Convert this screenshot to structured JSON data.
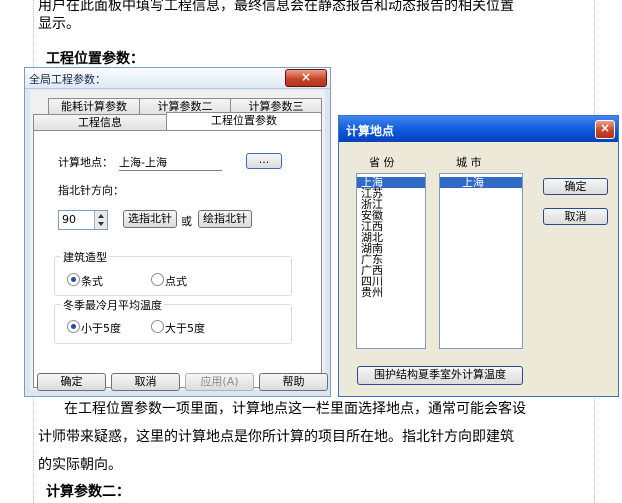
{
  "document": {
    "top_paragraph": [
      "用户在此面板中填写工程信息，最终信息会在静态报告和动态报告的相关位置",
      "显示。"
    ],
    "heading1": "工程位置参数：",
    "bottom_paragraph": [
      "在工程位置参数一项里面，计算地点这一栏里面选择地点，通常可能会客设",
      "计师带来疑惑，这里的计算地点是你所计算的项目所在地。指北针方向即建筑",
      "的实际朝向。"
    ],
    "heading2": "计算参数二："
  },
  "dialog1": {
    "title": "全局工程参数：",
    "close": "×",
    "tabs_row1": [
      "能耗计算参数",
      "计算参数二",
      "计算参数三"
    ],
    "tabs_row2": [
      "工程信息",
      "工程位置参数"
    ],
    "location_label": "计算地点：",
    "location_value": "上海-上海",
    "browse_button": "...",
    "north_label": "指北针方向：",
    "north_value": "90",
    "select_north_button": "选指北针",
    "or_label": "或",
    "draw_north_button": "绘指北针",
    "building_group": "建筑造型",
    "building_options": [
      "条式",
      "点式"
    ],
    "winter_group": "冬季最冷月平均温度",
    "winter_options": [
      "小于5度",
      "大于5度"
    ],
    "buttons": {
      "ok": "确定",
      "cancel": "取消",
      "apply": "应用(A)",
      "help": "帮助"
    }
  },
  "dialog2": {
    "title": "计算地点",
    "close": "×",
    "province_header": "省 份",
    "city_header": "城 市",
    "provinces": [
      "上海",
      "江苏",
      "浙江",
      "安徽",
      "江西",
      "湖北",
      "湖南",
      "广东",
      "广西",
      "四川",
      "贵州"
    ],
    "cities": [
      "上海"
    ],
    "ok_button": "确定",
    "cancel_button": "取消",
    "summer_button": "围护结构夏季室外计算温度"
  }
}
